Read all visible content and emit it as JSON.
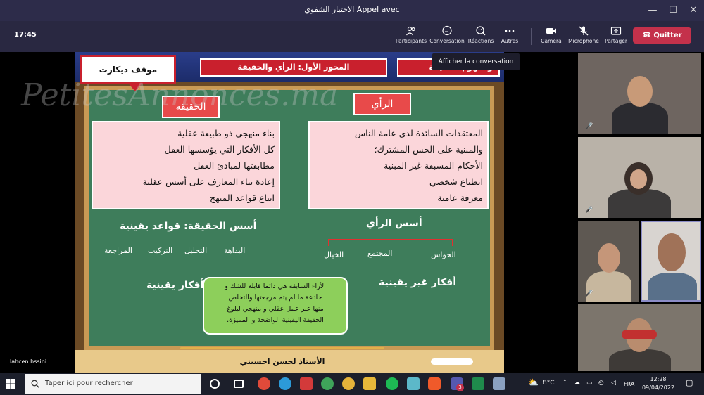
{
  "window": {
    "title": "الاختبار الشفوي Appel avec",
    "minimize_glyph": "—",
    "maximize_glyph": "☐",
    "close_glyph": "✕"
  },
  "toolbar": {
    "time": "17:45",
    "participants": "Participants",
    "conversation": "Conversation",
    "reactions": "Réactions",
    "more": "Autres",
    "camera": "Caméra",
    "microphone": "Microphone",
    "share": "Partager",
    "leave": "Quitter",
    "tooltip": "Afficher la conversation"
  },
  "slide": {
    "callout": "موقف ديكارت",
    "topic_main": "المحور الأول: الرأي والحقيقة",
    "topic_side": "ومفهوم الحقيقة",
    "watermark": "PetitesAnnonces.ma",
    "truth_label": "الحقيقة",
    "opinion_label": "الرأي",
    "truth_lines": [
      "بناء منهجي ذو طبيعة عقلية",
      "كل الأفكار التي يؤسسها العقل",
      "مطابقتها لمبادئ العقل",
      "إعادة بناء المعارف على أسس عقلية",
      "اتباع قواعد المنهج"
    ],
    "opinion_lines": [
      "المعتقدات السائدة لدى عامة الناس",
      "والمبنية على الحس المشترك؛",
      "الأحكام المسبقة غير المبنية",
      "انطباع شخصي",
      "معرفة عامية"
    ],
    "truth_foundations": "أسس الحقيقة: قواعد يقينية",
    "opinion_foundations": "أسس الرأي",
    "rules": [
      "البداهة",
      "التحليل",
      "التركيب",
      "المراجعة"
    ],
    "sources": [
      "الحواس",
      "المجتمع",
      "الخيال"
    ],
    "uncertain": "أفكار غير يقينية",
    "certain": "أفكار يقينية",
    "green_box_lines": [
      "الأراء السابقة هي دائما قابلة للشك و",
      "خادعة ما لم يتم مرجعتها والتخلص",
      "منها عبر عمل عقلي و منهجي لبلوغ",
      "الحقيقة اليقينية الواضحة و المميزة."
    ],
    "footer": "الأستاذ لحسن احسيني"
  },
  "presenter_name": "lahcen hssini",
  "taskbar": {
    "search_placeholder": "Taper ici pour rechercher",
    "weather": "8°C",
    "language": "FRA",
    "time": "12:28",
    "date": "09/04/2022",
    "notification_count": "3"
  },
  "colors": {
    "title_bar": "#2d2c4a",
    "toolbar": "#292841",
    "leave_button": "#c4314b",
    "board": "#3e7d5b",
    "red_label": "#e84a4a",
    "pink_box": "#fbd6da",
    "green_box": "#8dcf5b"
  }
}
